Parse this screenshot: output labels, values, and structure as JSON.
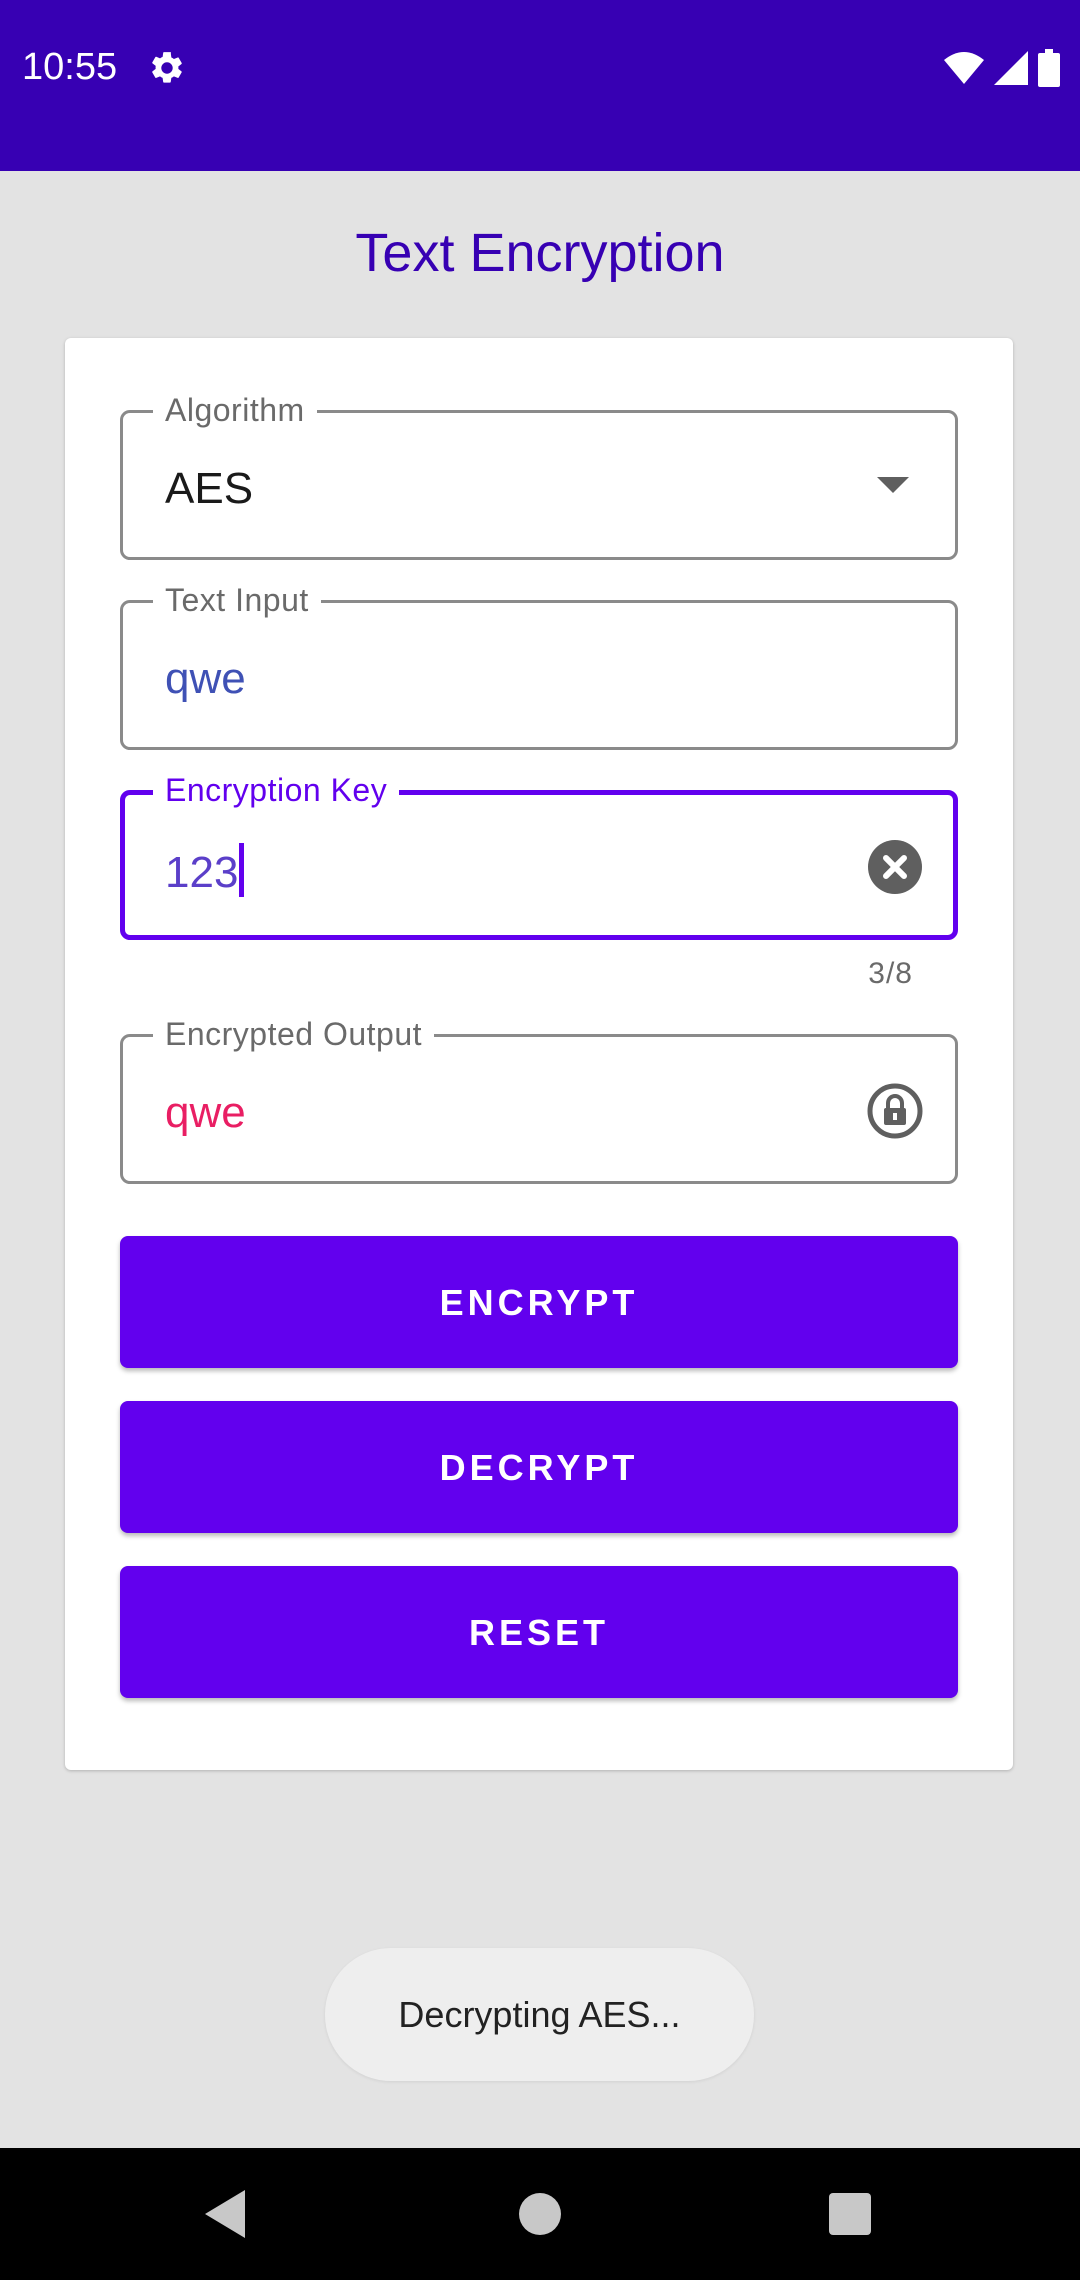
{
  "status_bar": {
    "time": "10:55",
    "icons": [
      "settings-icon",
      "wifi-icon",
      "signal-icon",
      "battery-icon"
    ]
  },
  "page": {
    "title": "Text Encryption"
  },
  "form": {
    "algorithm": {
      "label": "Algorithm",
      "value": "AES"
    },
    "text_input": {
      "label": "Text Input",
      "value": "qwe"
    },
    "encryption_key": {
      "label": "Encryption Key",
      "value": "123",
      "counter": "3/8"
    },
    "encrypted_output": {
      "label": "Encrypted Output",
      "value": "qwe"
    }
  },
  "buttons": {
    "encrypt": "ENCRYPT",
    "decrypt": "DECRYPT",
    "reset": "RESET"
  },
  "toast": {
    "message": "Decrypting AES..."
  },
  "colors": {
    "primary": "#6200ee",
    "primary_dark": "#3700b3",
    "text_input_value": "#3f51b5",
    "output_value": "#e91e63",
    "background": "#e3e3e3"
  }
}
